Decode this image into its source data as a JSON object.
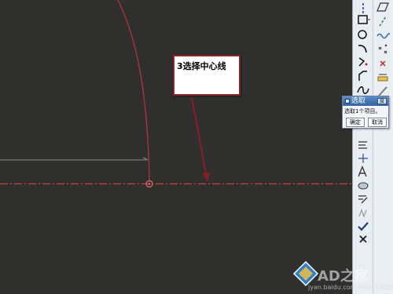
{
  "callout": {
    "text": "3选择中心线"
  },
  "select_dialog": {
    "title": "选取",
    "close_label": "⊠",
    "message": "选取1个项目。",
    "ok_label": "确定",
    "cancel_label": "取消"
  },
  "watermark": {
    "brand": "AD之家",
    "url": "jyan.baidu.com  www.CADZJ.com"
  },
  "colors": {
    "canvas_background": "#2f2f2d",
    "centerline": "#d2423c",
    "arc": "#b53338",
    "leader_arrow": "#8e1c24",
    "dimension_line": "#8c8c8c",
    "toolbar_background": "#e9eef4",
    "dialog_titlebar": "#2f62a8"
  },
  "toolbar": {
    "left_tools": [
      {
        "icon": "vertical-line-icon"
      },
      {
        "icon": "rectangle-icon"
      },
      {
        "icon": "circle-icon"
      },
      {
        "icon": "fillet-arc-icon"
      },
      {
        "icon": "corner-icon"
      },
      {
        "icon": "chamfer-icon"
      },
      {
        "icon": "spline-icon"
      }
    ],
    "right_tools": [
      {
        "icon": "parallelogram-icon"
      },
      {
        "icon": "diagonal-line-icon"
      },
      {
        "icon": "wave-icon"
      },
      {
        "icon": "scatter-points-icon"
      },
      {
        "icon": "point-x-icon"
      },
      {
        "icon": "dimension-icon"
      },
      {
        "icon": "pencil-icon"
      }
    ],
    "lower_tools": [
      {
        "icon": "offset-icon"
      },
      {
        "icon": "plus-axis-icon"
      },
      {
        "icon": "text-a-icon"
      },
      {
        "icon": "ellipse-icon"
      },
      {
        "icon": "mirror-icon"
      },
      {
        "icon": "pattern-icon"
      },
      {
        "icon": "check-icon"
      },
      {
        "icon": "close-x-icon"
      }
    ]
  }
}
